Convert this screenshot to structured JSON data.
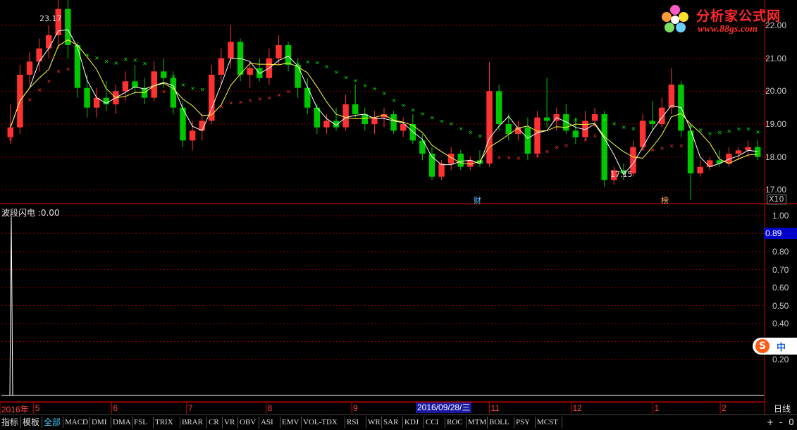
{
  "price_axis": {
    "labels": [
      "22.00",
      "21.00",
      "20.00",
      "19.00",
      "18.00",
      "17.00"
    ]
  },
  "indicator": {
    "title": "波段闪电 :0.00",
    "current_value": "0.89",
    "axis_labels": [
      "1.00",
      "0.90",
      "0.80",
      "0.70",
      "0.60",
      "0.50",
      "0.40",
      "0.30",
      "0.20"
    ]
  },
  "annotations": {
    "high": "23.17",
    "low": "17.15",
    "scale": "X10",
    "event_cai": "财",
    "event_bang": "榜"
  },
  "logo": {
    "name": "分析家公式网",
    "url": "www.88gs.com"
  },
  "ime": {
    "label": "中"
  },
  "date_axis": {
    "months": [
      {
        "label": "2016年",
        "pos": 0.0
      },
      {
        "label": "5",
        "pos": 0.044
      },
      {
        "label": "6",
        "pos": 0.146
      },
      {
        "label": "7",
        "pos": 0.244
      },
      {
        "label": "8",
        "pos": 0.348
      },
      {
        "label": "9",
        "pos": 0.46
      },
      {
        "label": "11",
        "pos": 0.64
      },
      {
        "label": "12",
        "pos": 0.747
      },
      {
        "label": "1",
        "pos": 0.854
      },
      {
        "label": "2",
        "pos": 0.942
      }
    ],
    "cursor_date": "2016/09/28/三",
    "period": "日线"
  },
  "tabs": [
    "指标",
    "模板",
    "全部",
    "MACD",
    "DMI",
    "DMA",
    "FSL",
    "TRIX",
    "BRAR",
    "CR",
    "VR",
    "OBV",
    "ASI",
    "EMV",
    "VOL-TDX",
    "RSI",
    "WR",
    "SAR",
    "KDJ",
    "CCI",
    "ROC",
    "MTM",
    "BOLL",
    "PSY",
    "MCST"
  ],
  "active_tab": "全部",
  "controls": [
    "+",
    "-",
    "0"
  ],
  "colors": {
    "up": "#ff3232",
    "down": "#00c800",
    "grid": "#8b0000",
    "sar_up": "#ff3232",
    "sar_down": "#00ff00"
  },
  "chart_data": {
    "type": "candlestick",
    "ylim": [
      16.6,
      22.6
    ],
    "ohlc": [
      [
        18.6,
        19.6,
        18.4,
        18.9
      ],
      [
        18.9,
        20.8,
        18.7,
        20.5
      ],
      [
        20.5,
        21.2,
        20.2,
        20.9
      ],
      [
        20.9,
        21.6,
        20.6,
        21.3
      ],
      [
        21.3,
        22.0,
        21.0,
        21.7
      ],
      [
        21.7,
        23.17,
        21.3,
        22.5
      ],
      [
        22.5,
        22.9,
        21.0,
        21.4
      ],
      [
        21.4,
        21.5,
        19.8,
        20.1
      ],
      [
        20.1,
        20.5,
        19.2,
        19.5
      ],
      [
        19.5,
        20.1,
        19.2,
        19.8
      ],
      [
        19.8,
        20.3,
        19.4,
        19.6
      ],
      [
        19.6,
        20.2,
        19.3,
        20.0
      ],
      [
        20.0,
        20.6,
        19.7,
        20.3
      ],
      [
        20.3,
        20.8,
        19.9,
        20.1
      ],
      [
        20.1,
        20.4,
        19.6,
        19.8
      ],
      [
        19.8,
        20.9,
        19.7,
        20.6
      ],
      [
        20.6,
        21.0,
        20.1,
        20.4
      ],
      [
        20.4,
        20.6,
        19.3,
        19.5
      ],
      [
        19.5,
        19.7,
        18.3,
        18.5
      ],
      [
        18.5,
        19.1,
        18.2,
        18.8
      ],
      [
        18.8,
        19.3,
        18.5,
        19.1
      ],
      [
        19.1,
        20.8,
        19.0,
        20.5
      ],
      [
        20.5,
        21.3,
        20.2,
        21.0
      ],
      [
        21.0,
        22.0,
        20.7,
        21.5
      ],
      [
        21.5,
        21.6,
        20.3,
        20.5
      ],
      [
        20.5,
        20.9,
        20.1,
        20.7
      ],
      [
        20.7,
        21.0,
        20.3,
        20.4
      ],
      [
        20.4,
        21.3,
        20.2,
        21.0
      ],
      [
        21.0,
        21.7,
        20.8,
        21.4
      ],
      [
        21.4,
        21.5,
        20.6,
        20.8
      ],
      [
        20.8,
        21.0,
        19.8,
        20.1
      ],
      [
        20.1,
        20.4,
        19.3,
        19.5
      ],
      [
        19.5,
        19.6,
        18.7,
        18.9
      ],
      [
        18.9,
        19.3,
        18.7,
        19.1
      ],
      [
        19.1,
        19.5,
        18.8,
        18.9
      ],
      [
        18.9,
        19.9,
        18.8,
        19.6
      ],
      [
        19.6,
        20.2,
        19.2,
        19.3
      ],
      [
        19.3,
        19.5,
        18.8,
        19.0
      ],
      [
        19.0,
        19.4,
        18.7,
        19.2
      ],
      [
        19.2,
        19.5,
        18.9,
        19.3
      ],
      [
        19.3,
        19.4,
        18.7,
        18.8
      ],
      [
        18.8,
        19.2,
        18.6,
        19.0
      ],
      [
        19.0,
        19.3,
        18.4,
        18.5
      ],
      [
        18.5,
        18.7,
        17.9,
        18.1
      ],
      [
        18.1,
        18.3,
        17.3,
        17.4
      ],
      [
        17.4,
        17.9,
        17.3,
        17.8
      ],
      [
        17.8,
        18.3,
        17.6,
        18.1
      ],
      [
        18.1,
        18.2,
        17.6,
        17.7
      ],
      [
        17.7,
        18.0,
        17.6,
        17.9
      ],
      [
        17.9,
        18.2,
        17.7,
        17.8
      ],
      [
        17.8,
        20.9,
        17.7,
        20.0
      ],
      [
        20.0,
        20.2,
        18.8,
        19.0
      ],
      [
        19.0,
        19.3,
        18.5,
        18.7
      ],
      [
        18.7,
        19.1,
        18.5,
        18.9
      ],
      [
        18.9,
        19.2,
        17.9,
        18.1
      ],
      [
        18.1,
        19.4,
        18.0,
        19.2
      ],
      [
        19.2,
        20.4,
        18.9,
        19.1
      ],
      [
        19.1,
        19.5,
        18.8,
        19.3
      ],
      [
        19.3,
        19.6,
        18.7,
        18.8
      ],
      [
        18.8,
        19.2,
        18.4,
        18.6
      ],
      [
        18.6,
        19.4,
        18.5,
        19.1
      ],
      [
        19.1,
        19.5,
        18.9,
        19.3
      ],
      [
        19.3,
        19.4,
        17.1,
        17.3
      ],
      [
        17.3,
        17.7,
        17.15,
        17.6
      ],
      [
        17.6,
        17.8,
        17.3,
        17.5
      ],
      [
        17.5,
        18.5,
        17.4,
        18.3
      ],
      [
        18.3,
        19.3,
        18.2,
        19.1
      ],
      [
        19.1,
        19.7,
        18.8,
        19.0
      ],
      [
        19.0,
        19.8,
        18.9,
        19.5
      ],
      [
        19.5,
        20.7,
        19.3,
        20.2
      ],
      [
        20.2,
        20.3,
        18.6,
        18.8
      ],
      [
        18.8,
        19.0,
        16.7,
        17.5
      ],
      [
        17.5,
        17.9,
        17.4,
        17.7
      ],
      [
        17.7,
        18.0,
        17.6,
        17.9
      ],
      [
        17.9,
        18.2,
        17.7,
        17.8
      ],
      [
        17.8,
        18.3,
        17.7,
        18.1
      ],
      [
        18.1,
        18.3,
        17.9,
        18.2
      ],
      [
        18.2,
        18.5,
        18.0,
        18.3
      ],
      [
        18.3,
        18.5,
        17.9,
        18.0
      ]
    ],
    "indicator_values": [
      0.0,
      0.0,
      0.0,
      0.0,
      0.0,
      1.0,
      0.0,
      0.0,
      0.0,
      0.0,
      0.0,
      0.0,
      0.0,
      0.0,
      0.0,
      0.0
    ]
  }
}
